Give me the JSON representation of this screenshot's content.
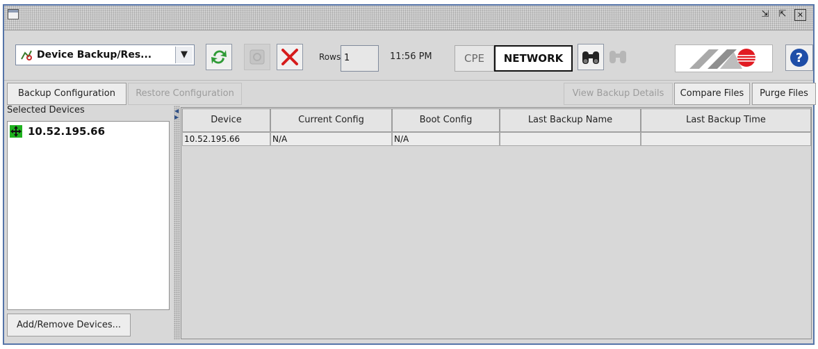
{
  "window": {
    "controls": {
      "restore": "⇲",
      "maximize": "⇱",
      "close": "✕"
    }
  },
  "toolbar": {
    "module_select": {
      "value": "Device Backup/Res...",
      "icon": "network-tool-icon"
    },
    "rows_label": "Rows",
    "rows_value": "1",
    "time": "11:56 PM",
    "cpe_label": "CPE",
    "network_label": "NETWORK",
    "colors": {
      "refresh": "#2f9a36",
      "delete": "#d61c1c",
      "help": "#1f4ea8",
      "logo_red": "#e11b22"
    }
  },
  "actions": {
    "backup": "Backup Configuration",
    "restore": "Restore Configuration",
    "view_details": "View Backup Details",
    "compare": "Compare Files",
    "purge": "Purge Files"
  },
  "left_panel": {
    "title": "Selected Devices",
    "devices": [
      {
        "name": "10.52.195.66"
      }
    ],
    "add_remove": "Add/Remove Devices..."
  },
  "table": {
    "columns": [
      "Device",
      "Current Config",
      "Boot Config",
      "Last Backup Name",
      "Last Backup Time"
    ],
    "rows": [
      [
        "10.52.195.66",
        "N/A",
        "N/A",
        "",
        ""
      ]
    ]
  }
}
